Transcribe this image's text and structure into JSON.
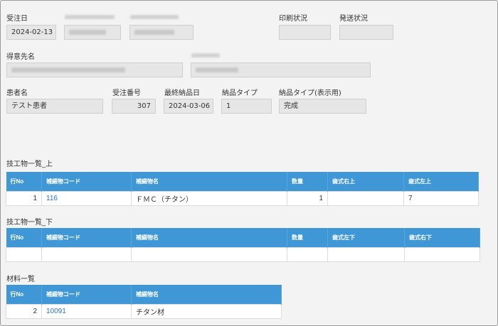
{
  "header_row": {
    "order_date_label": "受注日",
    "order_date_value": "2024-02-13",
    "print_status_label": "印刷状況",
    "print_status_value": "",
    "ship_status_label": "発送状況",
    "ship_status_value": ""
  },
  "customer": {
    "label": "得意先名",
    "value": ""
  },
  "detail_row": {
    "patient_label": "患者名",
    "patient_value": "テスト患者",
    "order_no_label": "受注番号",
    "order_no_value": "307",
    "last_delivery_label": "最終納品日",
    "last_delivery_value": "2024-03-06",
    "delivery_type_label": "納品タイプ",
    "delivery_type_value": "1",
    "delivery_type_display_label": "納品タイプ(表示用)",
    "delivery_type_display_value": "完成"
  },
  "upper_list": {
    "title": "技工物一覧_上",
    "columns": [
      "行No",
      "補綴物コード",
      "補綴物名",
      "数量",
      "歯式右上",
      "歯式左上"
    ],
    "rows": [
      {
        "row_no": "1",
        "code": "116",
        "name": "ＦＭＣ（チタン）",
        "qty": "1",
        "right": "",
        "left": "7"
      }
    ]
  },
  "lower_list": {
    "title": "技工物一覧_下",
    "columns": [
      "行No",
      "補綴物コード",
      "補綴物名",
      "数量",
      "歯式左下",
      "歯式右下"
    ],
    "rows": [
      {
        "row_no": "",
        "code": "",
        "name": "",
        "qty": "",
        "left": "",
        "right": ""
      }
    ]
  },
  "material_list": {
    "title": "材料一覧",
    "columns": [
      "行No",
      "補綴物コード",
      "補綴物名"
    ],
    "rows": [
      {
        "row_no": "2",
        "code": "10091",
        "name": "チタン材"
      }
    ]
  },
  "colors": {
    "header_blue": "#3f97d6",
    "link_blue": "#2e74c9",
    "field_gray": "#e6e6e6"
  }
}
